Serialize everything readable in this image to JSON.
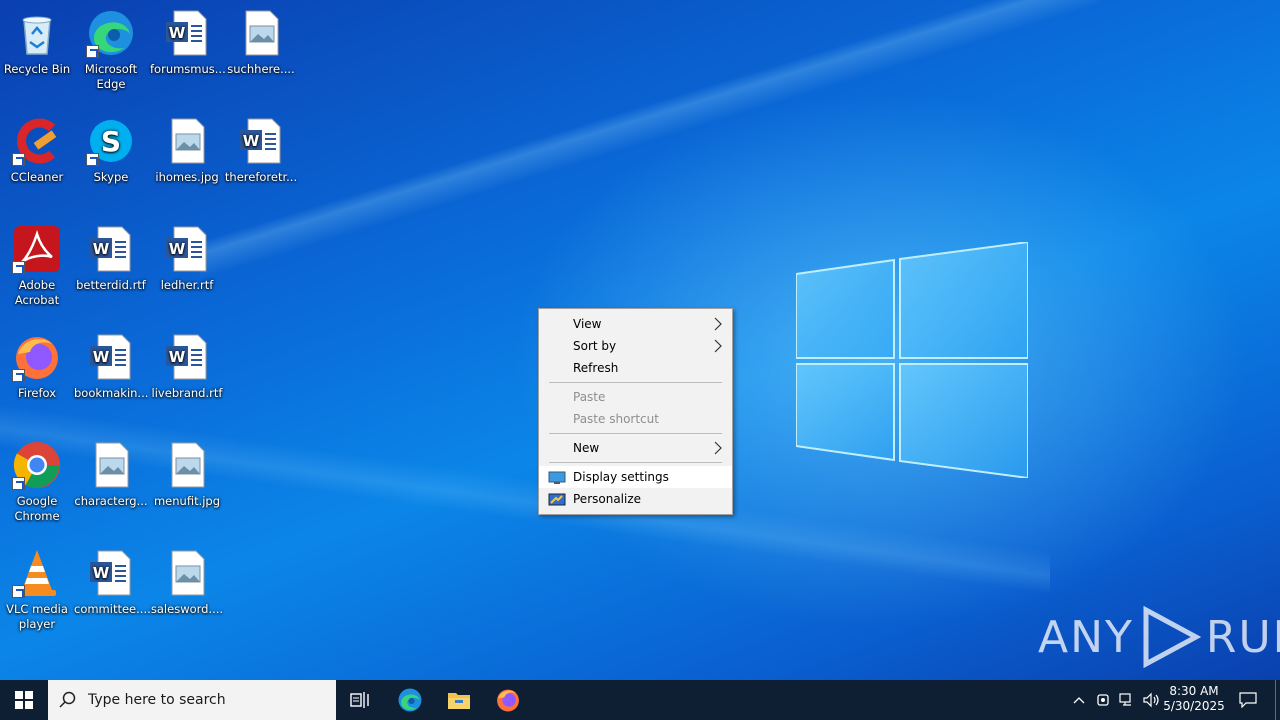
{
  "desktop": {
    "icons": [
      {
        "label": "Recycle Bin",
        "icon": "recycle-bin-icon"
      },
      {
        "label": "Microsoft Edge",
        "icon": "edge-icon"
      },
      {
        "label": "forumsmus...",
        "icon": "word-document-icon"
      },
      {
        "label": "suchhere....",
        "icon": "image-file-icon"
      },
      {
        "label": "CCleaner",
        "icon": "ccleaner-icon"
      },
      {
        "label": "Skype",
        "icon": "skype-icon"
      },
      {
        "label": "ihomes.jpg",
        "icon": "image-file-icon"
      },
      {
        "label": "thereforetr...",
        "icon": "word-document-icon"
      },
      {
        "label": "Adobe Acrobat",
        "icon": "acrobat-icon"
      },
      {
        "label": "betterdid.rtf",
        "icon": "word-document-icon"
      },
      {
        "label": "ledher.rtf",
        "icon": "word-document-icon"
      },
      {
        "label": "Firefox",
        "icon": "firefox-icon"
      },
      {
        "label": "bookmakin...",
        "icon": "word-document-icon"
      },
      {
        "label": "livebrand.rtf",
        "icon": "word-document-icon"
      },
      {
        "label": "Google Chrome",
        "icon": "chrome-icon"
      },
      {
        "label": "characterg...",
        "icon": "image-file-icon"
      },
      {
        "label": "menufit.jpg",
        "icon": "image-file-icon"
      },
      {
        "label": "VLC media player",
        "icon": "vlc-icon"
      },
      {
        "label": "committee....",
        "icon": "word-document-icon"
      },
      {
        "label": "salesword....",
        "icon": "image-file-icon"
      }
    ]
  },
  "context_menu": {
    "view": "View",
    "sort_by": "Sort by",
    "refresh": "Refresh",
    "paste": "Paste",
    "paste_shortcut": "Paste shortcut",
    "new": "New",
    "display_settings": "Display settings",
    "personalize": "Personalize"
  },
  "taskbar": {
    "search_placeholder": "Type here to search",
    "time": "8:30 AM",
    "date": "5/30/2025"
  },
  "watermark": {
    "text_left": "ANY",
    "text_right": "RUN"
  },
  "colors": {
    "taskbar": "#0f1f33",
    "menu_bg": "#f2f2f2",
    "accent": "#0078d7"
  }
}
